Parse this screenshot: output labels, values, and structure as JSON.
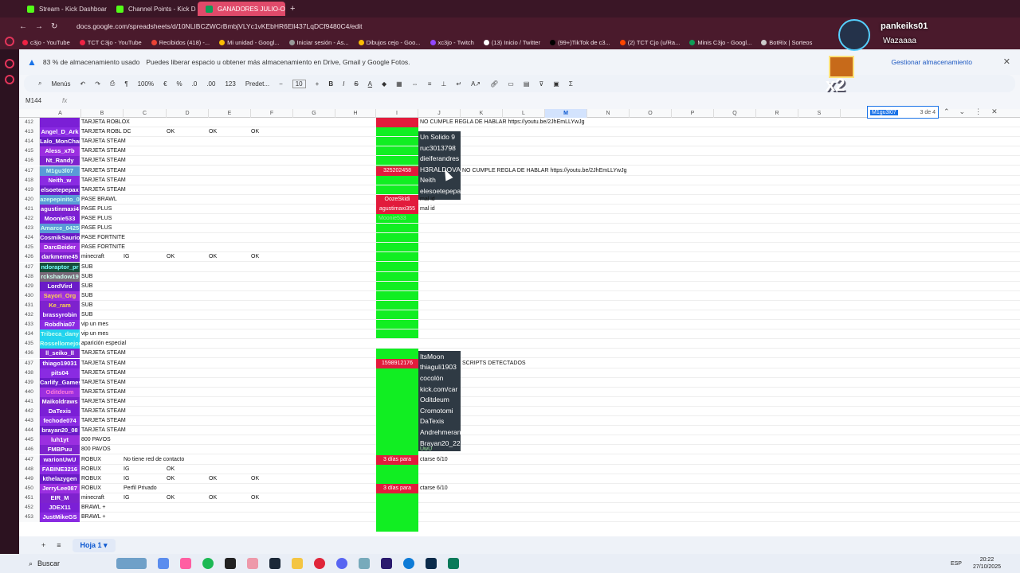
{
  "browser": {
    "tabs": [
      {
        "label": "Stream - Kick Dashboard",
        "active": false
      },
      {
        "label": "Channel Points - Kick Da",
        "active": false
      },
      {
        "label": "GANADORES JULIO-OCT",
        "active": true
      }
    ],
    "url": "docs.google.com/spreadsheets/d/10NLIBCZWCrBmbjVLYc1vKEbHR6Ell437LqDCf9480C4/edit",
    "bookmarks": [
      "c3jo - YouTube",
      "TCT C3jo - YouTube",
      "Recibidos (418) -...",
      "Mi unidad - Googl...",
      "Iniciar sesión - As...",
      "Dibujos cejo - Goo...",
      "xc3jo - Twitch",
      "(13) Inicio / Twitter",
      "(99+)TikTok de c3...",
      "(2) TCT Cjo (u/Ra...",
      "Minis C3jo - Googl...",
      "BotRix | Sorteos"
    ]
  },
  "notice": {
    "title": "83 % de almacenamiento usado",
    "text": "Puedes liberar espacio u obtener más almacenamiento en Drive, Gmail y Google Fotos.",
    "action": "Gestionar almacenamiento"
  },
  "toolbar": {
    "menus": "Menús",
    "zoom": "100%",
    "format_num": "123",
    "font": "Predet...",
    "font_size": "10"
  },
  "formula": {
    "cell_ref": "M144",
    "fx": "fx"
  },
  "columns": [
    "A",
    "B",
    "C",
    "D",
    "E",
    "F",
    "G",
    "H",
    "I",
    "J",
    "K",
    "L",
    "M",
    "N",
    "O",
    "P",
    "Q",
    "R",
    "S"
  ],
  "find": {
    "query": "M1gu3l07",
    "count": "3 de 4"
  },
  "overlay": {
    "user": "pankeiks01",
    "message": "Wazaaaa",
    "multiplier": "x2"
  },
  "rows": [
    {
      "n": "412",
      "name": "",
      "prize": "TARJETA ROBLOX",
      "c": "",
      "d": "",
      "e": "",
      "f": ""
    },
    {
      "n": "413",
      "name": "Angel_D_Ark",
      "prize": "TARJETA ROBL DC",
      "c": "",
      "d": "OK",
      "e": "OK",
      "f": "OK"
    },
    {
      "n": "414",
      "name": "Lalo_MonChar",
      "prize": "TARJETA STEAM",
      "c": "",
      "d": "",
      "e": "",
      "f": ""
    },
    {
      "n": "415",
      "name": "Aless_x7b",
      "prize": "TARJETA STEAM",
      "c": "",
      "d": "",
      "e": "",
      "f": ""
    },
    {
      "n": "416",
      "name": "Nt_Randy",
      "prize": "TARJETA STEAM",
      "c": "",
      "d": "",
      "e": "",
      "f": ""
    },
    {
      "n": "417",
      "name": "M1gu3l07",
      "prize": "TARJETA STEAM",
      "c": "",
      "d": "",
      "e": "",
      "f": ""
    },
    {
      "n": "418",
      "name": "Neith_w",
      "prize": "TARJETA STEAM",
      "c": "",
      "d": "",
      "e": "",
      "f": ""
    },
    {
      "n": "419",
      "name": "elsoetepepax",
      "prize": "TARJETA STEAM",
      "c": "",
      "d": "",
      "e": "",
      "f": ""
    },
    {
      "n": "420",
      "name": "azepepinito_0",
      "prize": "PASE BRAWL",
      "c": "",
      "d": "",
      "e": "",
      "f": ""
    },
    {
      "n": "421",
      "name": "agustinmaxi4",
      "prize": "PASE PLUS",
      "c": "",
      "d": "",
      "e": "",
      "f": ""
    },
    {
      "n": "422",
      "name": "Moonie533",
      "prize": "PASE PLUS",
      "c": "",
      "d": "",
      "e": "",
      "f": ""
    },
    {
      "n": "423",
      "name": "Amarce_0425",
      "prize": "PASE PLUS",
      "c": "",
      "d": "",
      "e": "",
      "f": ""
    },
    {
      "n": "424",
      "name": "CosmikSaurio",
      "prize": "PASE FORTNITE",
      "c": "",
      "d": "",
      "e": "",
      "f": ""
    },
    {
      "n": "425",
      "name": "DarcBeider",
      "prize": "PASE FORTNITE",
      "c": "",
      "d": "",
      "e": "",
      "f": ""
    },
    {
      "n": "426",
      "name": "darkmeme45",
      "prize": "minecraft",
      "c": "IG",
      "d": "OK",
      "e": "OK",
      "f": "OK"
    },
    {
      "n": "427",
      "name": "ndoraptor_pr",
      "prize": "SUB",
      "c": "",
      "d": "",
      "e": "",
      "f": ""
    },
    {
      "n": "428",
      "name": "rckshadow19",
      "prize": "SUB",
      "c": "",
      "d": "",
      "e": "",
      "f": ""
    },
    {
      "n": "429",
      "name": "LordVird",
      "prize": "SUB",
      "c": "",
      "d": "",
      "e": "",
      "f": ""
    },
    {
      "n": "430",
      "name": "Sayori_Org",
      "prize": "SUB",
      "c": "",
      "d": "",
      "e": "",
      "f": ""
    },
    {
      "n": "431",
      "name": "Ke_ram",
      "prize": "SUB",
      "c": "",
      "d": "",
      "e": "",
      "f": ""
    },
    {
      "n": "432",
      "name": "brassyrobin",
      "prize": "SUB",
      "c": "",
      "d": "",
      "e": "",
      "f": ""
    },
    {
      "n": "433",
      "name": "Robdhia07",
      "prize": "vip un mes",
      "c": "",
      "d": "",
      "e": "",
      "f": ""
    },
    {
      "n": "434",
      "name": "Tribeca_dany",
      "prize": "vip un mes",
      "c": "",
      "d": "",
      "e": "",
      "f": ""
    },
    {
      "n": "435",
      "name": "Rossellomejor",
      "prize": "aparición especial",
      "c": "",
      "d": "",
      "e": "",
      "f": ""
    },
    {
      "n": "436",
      "name": "ll_seiko_ll",
      "prize": "TARJETA STEAM",
      "c": "",
      "d": "",
      "e": "",
      "f": ""
    },
    {
      "n": "437",
      "name": "thiago19031",
      "prize": "TARJETA STEAM",
      "c": "",
      "d": "",
      "e": "",
      "f": ""
    },
    {
      "n": "438",
      "name": "pits04",
      "prize": "TARJETA STEAM",
      "c": "",
      "d": "",
      "e": "",
      "f": ""
    },
    {
      "n": "439",
      "name": "Carlify_Games",
      "prize": "TARJETA STEAM",
      "c": "",
      "d": "",
      "e": "",
      "f": ""
    },
    {
      "n": "440",
      "name": "Oditdeum",
      "prize": "TARJETA STEAM",
      "c": "",
      "d": "",
      "e": "",
      "f": ""
    },
    {
      "n": "441",
      "name": "Maikoldraws",
      "prize": "TARJETA STEAM",
      "c": "",
      "d": "",
      "e": "",
      "f": ""
    },
    {
      "n": "442",
      "name": "DaTexis",
      "prize": "TARJETA STEAM",
      "c": "",
      "d": "",
      "e": "",
      "f": ""
    },
    {
      "n": "443",
      "name": "fechode074",
      "prize": "TARJETA STEAM",
      "c": "",
      "d": "",
      "e": "",
      "f": ""
    },
    {
      "n": "444",
      "name": "brayan20_08",
      "prize": "TARJETA STEAM",
      "c": "",
      "d": "",
      "e": "",
      "f": ""
    },
    {
      "n": "445",
      "name": "luh1yt",
      "prize": "800 PAVOS",
      "c": "",
      "d": "",
      "e": "",
      "f": ""
    },
    {
      "n": "446",
      "name": "FMBPuu",
      "prize": "800 PAVOS",
      "c": "",
      "d": "",
      "e": "",
      "f": ""
    },
    {
      "n": "447",
      "name": "warionUwU",
      "prize": "ROBUX",
      "c": "No tiene red de contacto",
      "d": "",
      "e": "",
      "f": ""
    },
    {
      "n": "448",
      "name": "FABINE3216",
      "prize": "ROBUX",
      "c": "IG",
      "d": "OK",
      "e": "",
      "f": ""
    },
    {
      "n": "449",
      "name": "kthelazygen",
      "prize": "ROBUX",
      "c": "IG",
      "d": "OK",
      "e": "OK",
      "f": "OK"
    },
    {
      "n": "450",
      "name": "JerryLee087",
      "prize": "ROBUX",
      "c": "Perfil Privado",
      "d": "",
      "e": "",
      "f": ""
    },
    {
      "n": "451",
      "name": "EIR_M",
      "prize": "minecraft",
      "c": "IG",
      "d": "OK",
      "e": "OK",
      "f": "OK"
    },
    {
      "n": "452",
      "name": "JDEX11",
      "prize": "BRAWL +",
      "c": "",
      "d": "",
      "e": "",
      "f": ""
    },
    {
      "n": "453",
      "name": "JustMikeGS",
      "prize": "BRAWL +",
      "c": "",
      "d": "",
      "e": "",
      "f": ""
    }
  ],
  "col_i_red": [
    {
      "row": 0,
      "text": ""
    },
    {
      "row": 5,
      "text": "325202458"
    },
    {
      "row": 8,
      "text": "OozeSkidi"
    },
    {
      "row": 9,
      "text": "agustimaxi355"
    },
    {
      "row": 25,
      "text": "1598912176"
    },
    {
      "row": 35,
      "text": "3 días para"
    },
    {
      "row": 38,
      "text": "3 días para"
    }
  ],
  "box1": [
    "Un Solido 9",
    "ruc3013798",
    "dieiferandres",
    "H3RALDOVA",
    "Neith",
    "elesoetepepa"
  ],
  "box2": [
    "ItsMoon",
    "thiaguli1903",
    "cocolón",
    "kick.com/car",
    "Oditdeum",
    "Cromotomi",
    "DaTexis",
    "Andrehmeran",
    "Brayan20_22"
  ],
  "col_j_notes": [
    {
      "row": 0,
      "text": "NO CUMPLE REGLA DE HABLAR https://youtu.be/2JhEmLLYwJg"
    },
    {
      "row": 5,
      "text": "NO CUMPLE REGLA DE HABLAR https://youtu.be/2JhEmLLYwJg"
    },
    {
      "row": 8,
      "text": "mal id"
    },
    {
      "row": 9,
      "text": "mal id"
    },
    {
      "row": 25,
      "text": "SCRIPTS DETECTADOS"
    },
    {
      "row": 35,
      "text": "ctarse 6/10"
    },
    {
      "row": 38,
      "text": "ctarse 6/10"
    },
    {
      "row": 34,
      "text": "UwU"
    },
    {
      "row": 10,
      "text": "Moonie533"
    }
  ],
  "bottom": {
    "sheet": "Hoja 1"
  },
  "taskbar": {
    "search": "Buscar",
    "lang": "ESP",
    "time": "20:22",
    "date": "27/10/2025"
  }
}
